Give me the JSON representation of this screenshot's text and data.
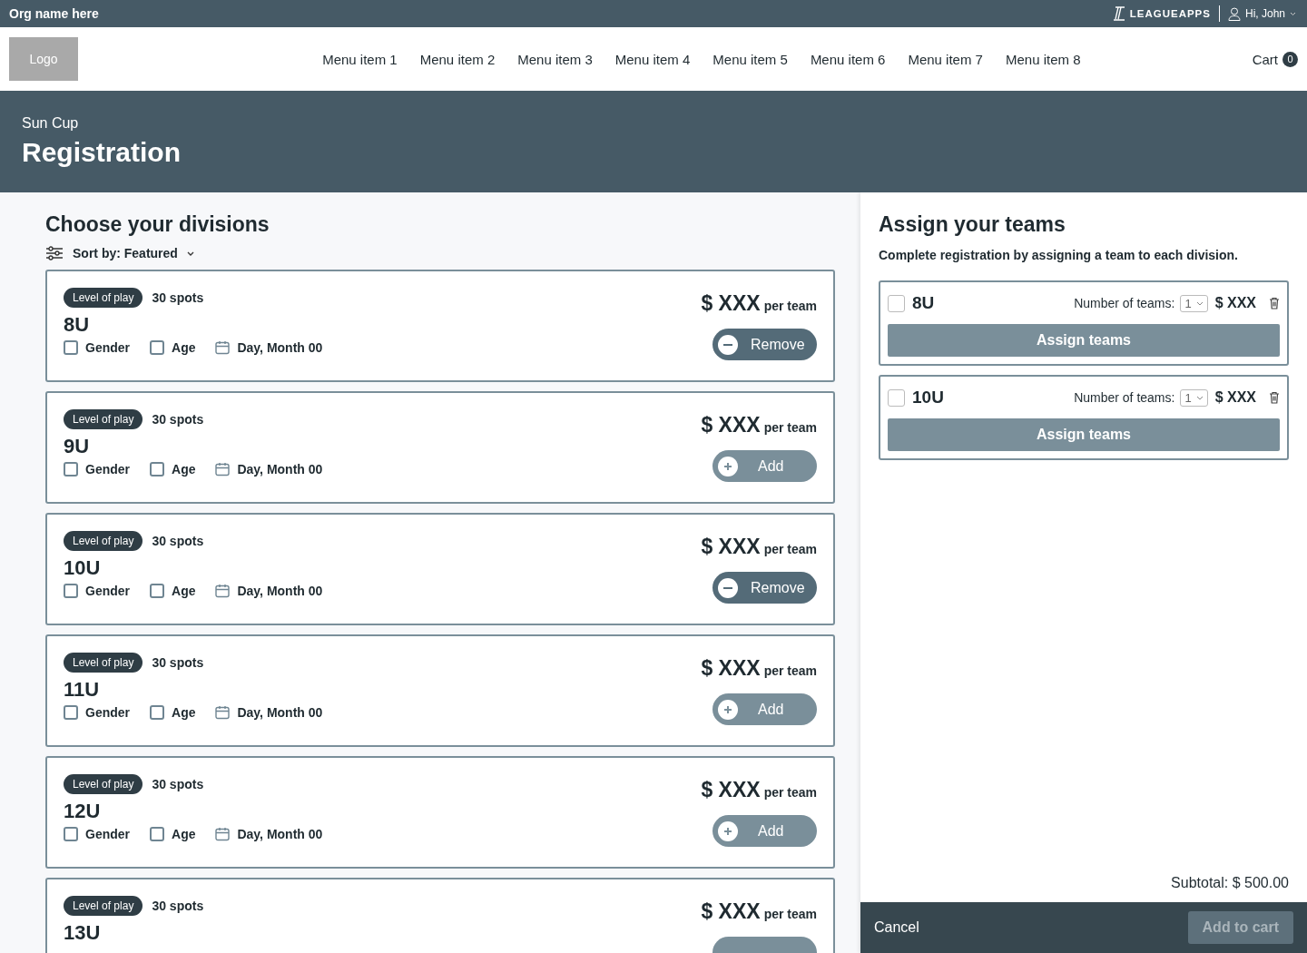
{
  "topbar": {
    "org": "Org name here",
    "brand": "LEAGUEAPPS",
    "user": "Hi, John"
  },
  "nav": {
    "logo": "Logo",
    "items": [
      "Menu item 1",
      "Menu item 2",
      "Menu item 3",
      "Menu item 4",
      "Menu item 5",
      "Menu item 6",
      "Menu item 7",
      "Menu item 8"
    ],
    "cart": "Cart",
    "cart_count": "0"
  },
  "hero": {
    "subtitle": "Sun Cup",
    "title": "Registration"
  },
  "divisions_panel": {
    "title": "Choose your divisions",
    "sort": "Sort by: Featured",
    "divisions": [
      {
        "tag": "Level of play",
        "spots": "30 spots",
        "name": "8U",
        "price": "$ XXX",
        "unit": "per team",
        "options": [
          {
            "label": "Gender",
            "checked": false
          },
          {
            "label": "Age",
            "checked": false
          }
        ],
        "date": "Day, Month 00",
        "kind": "remove",
        "button": "Remove"
      },
      {
        "tag": "Level of play",
        "spots": "30 spots",
        "name": "9U",
        "price": "$ XXX",
        "unit": "per team",
        "options": [
          {
            "label": "Gender",
            "checked": false
          },
          {
            "label": "Age",
            "checked": false
          }
        ],
        "date": "Day, Month 00",
        "kind": "add",
        "button": "Add"
      },
      {
        "tag": "Level of play",
        "spots": "30 spots",
        "name": "10U",
        "price": "$ XXX",
        "unit": "per team",
        "options": [
          {
            "label": "Gender",
            "checked": false
          },
          {
            "label": "Age",
            "checked": false
          }
        ],
        "date": "Day, Month 00",
        "kind": "remove",
        "button": "Remove"
      },
      {
        "tag": "Level of play",
        "spots": "30 spots",
        "name": "11U",
        "price": "$ XXX",
        "unit": "per team",
        "options": [
          {
            "label": "Gender",
            "checked": false
          },
          {
            "label": "Age",
            "checked": false
          }
        ],
        "date": "Day, Month 00",
        "kind": "add",
        "button": "Add"
      },
      {
        "tag": "Level of play",
        "spots": "30 spots",
        "name": "12U",
        "price": "$ XXX",
        "unit": "per team",
        "options": [
          {
            "label": "Gender",
            "checked": false
          },
          {
            "label": "Age",
            "checked": false
          }
        ],
        "date": "Day, Month 00",
        "kind": "add",
        "button": "Add"
      },
      {
        "tag": "Level of play",
        "spots": "30 spots",
        "name": "13U",
        "price": "$ XXX",
        "unit": "per team",
        "kind": "add"
      }
    ]
  },
  "assign_panel": {
    "title": "Assign your teams",
    "description": "Complete registration by assigning a team to each division.",
    "assignments": [
      {
        "name": "8U",
        "checked": false,
        "count_label": "Number of teams:",
        "count": "1",
        "price": "$ XXX",
        "button": "Assign teams"
      },
      {
        "name": "10U",
        "checked": false,
        "count_label": "Number of teams:",
        "count": "1",
        "price": "$ XXX",
        "button": "Assign teams"
      }
    ],
    "subtotal": "Subtotal: $ 500.00"
  },
  "footer": {
    "cancel": "Cancel",
    "add_to_cart": "Add to cart",
    "add_to_cart_disabled": true
  }
}
